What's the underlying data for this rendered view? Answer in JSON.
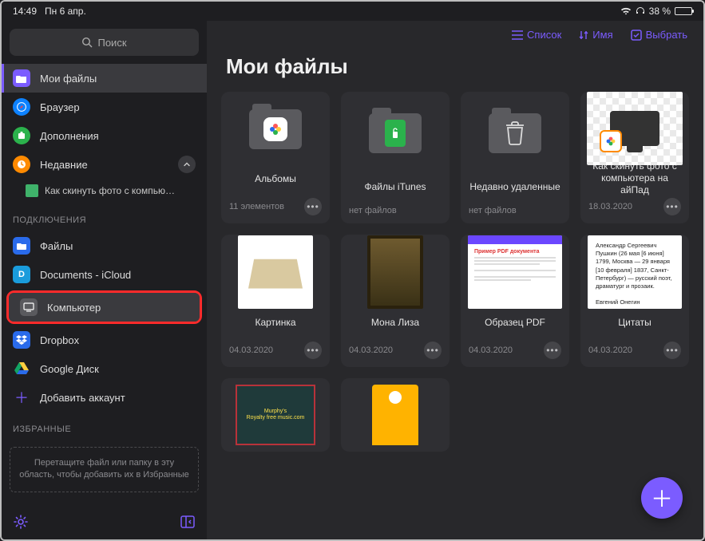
{
  "statusbar": {
    "time": "14:49",
    "date": "Пн 6 апр.",
    "battery": "38 %"
  },
  "sidebar": {
    "search_placeholder": "Поиск",
    "nav": [
      {
        "label": "Мои файлы"
      },
      {
        "label": "Браузер"
      },
      {
        "label": "Дополнения"
      },
      {
        "label": "Недавние"
      }
    ],
    "recent_sub": "Как скинуть фото с компью…",
    "section_connections": "ПОДКЛЮЧЕНИЯ",
    "connections": [
      {
        "label": "Файлы"
      },
      {
        "label": "Documents - iCloud"
      },
      {
        "label": "Компьютер"
      },
      {
        "label": "Dropbox"
      },
      {
        "label": "Google Диск"
      },
      {
        "label": "Добавить аккаунт"
      }
    ],
    "section_favorites": "ИЗБРАННЫЕ",
    "favorites_hint": "Перетащите файл или папку в эту область, чтобы добавить их в Избранные"
  },
  "toolbar": {
    "list": "Список",
    "name": "Имя",
    "select": "Выбрать"
  },
  "page_title": "Мои файлы",
  "cards": [
    {
      "title": "Альбомы",
      "sub": "11 элементов"
    },
    {
      "title": "Файлы iTunes",
      "sub": "нет файлов"
    },
    {
      "title": "Недавно удаленные",
      "sub": "нет файлов"
    },
    {
      "title": "Как скинуть фото с компьютера на айПад",
      "sub": "18.03.2020"
    },
    {
      "title": "Картинка",
      "sub": "04.03.2020"
    },
    {
      "title": "Мона Лиза",
      "sub": "04.03.2020"
    },
    {
      "title": "Образец PDF",
      "sub": "04.03.2020"
    },
    {
      "title": "Цитаты",
      "sub": "04.03.2020"
    }
  ],
  "quotes_text": "Александр Сергеевич Пушкин (26 мая [6 июня] 1799, Москва — 29 января [10 февраля] 1837, Санкт-Петербург) — русский поэт, драматург и прозаик.\n\nЕвгений Онегин",
  "pdf_header": "Пример PDF документа",
  "music_label": "Murphy's\nRoyalty free music.com"
}
